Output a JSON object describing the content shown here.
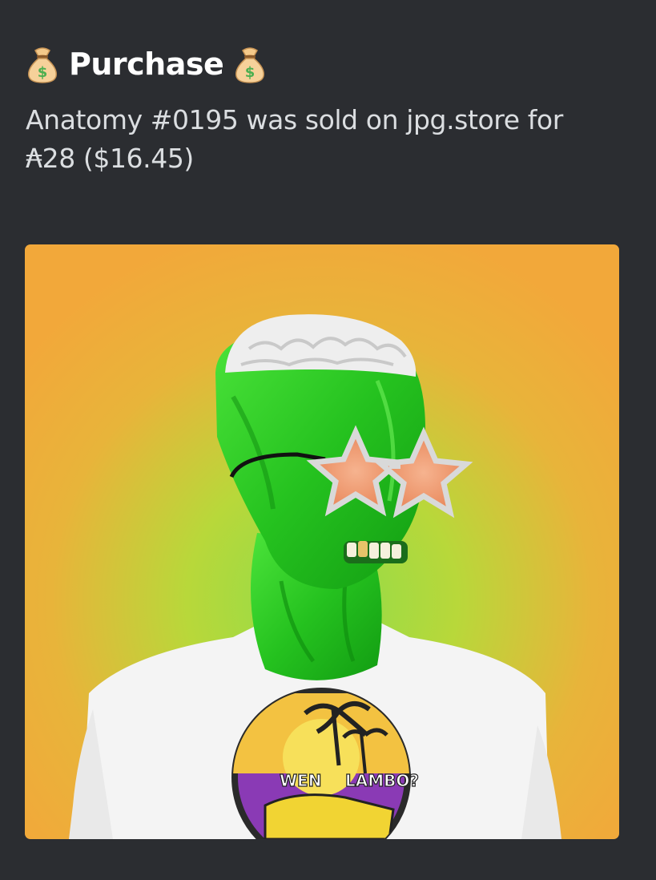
{
  "embed": {
    "title": "Purchase",
    "title_left_icon": "money-bag-icon",
    "title_right_icon": "money-bag-icon",
    "description_line1": "Anatomy #0195 was sold on jpg.store for",
    "description_line2": "₳28 ($16.45)",
    "image": {
      "subject": "nft-artwork",
      "shirt_text_left": "WEN",
      "shirt_text_right": "LAMBO?",
      "background_color": "#f0a83a",
      "glow_color": "#7ed957",
      "figure_color": "#2ec92a"
    }
  },
  "colors": {
    "background": "#2b2d31",
    "title": "#ffffff",
    "text": "#dbdee1"
  }
}
